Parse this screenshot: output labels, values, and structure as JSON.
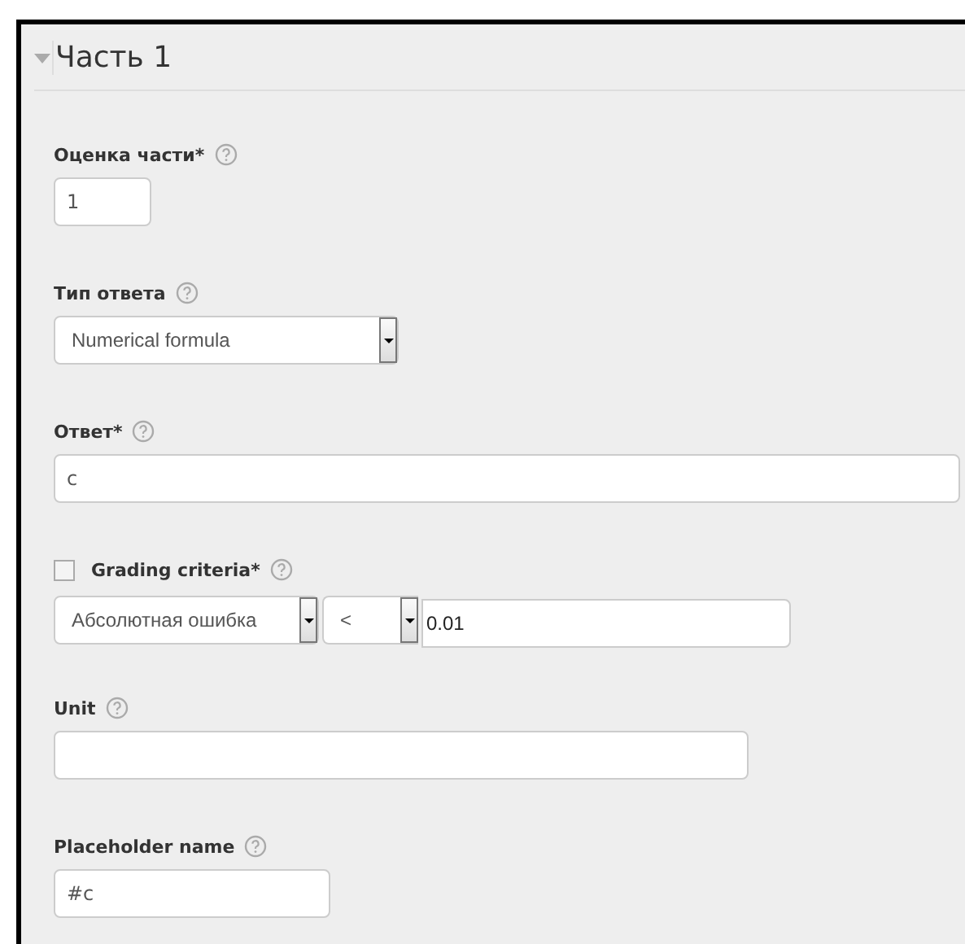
{
  "section": {
    "title": "Часть 1",
    "expanded": true
  },
  "fields": [
    {
      "kind": "text",
      "label": "Оценка части*",
      "value": "1"
    },
    {
      "kind": "select",
      "label": "Тип ответа",
      "value": "Numerical formula"
    },
    {
      "kind": "text",
      "label": "Ответ*",
      "value": "c"
    },
    {
      "kind": "criteria",
      "label": "Grading criteria*",
      "checked": false,
      "error_type": "Абсолютная ошибка",
      "comparison": "<",
      "value": "0.01"
    },
    {
      "kind": "text",
      "label": "Unit"
    },
    {
      "kind": "text",
      "label": "Placeholder name",
      "value": "#c"
    }
  ]
}
